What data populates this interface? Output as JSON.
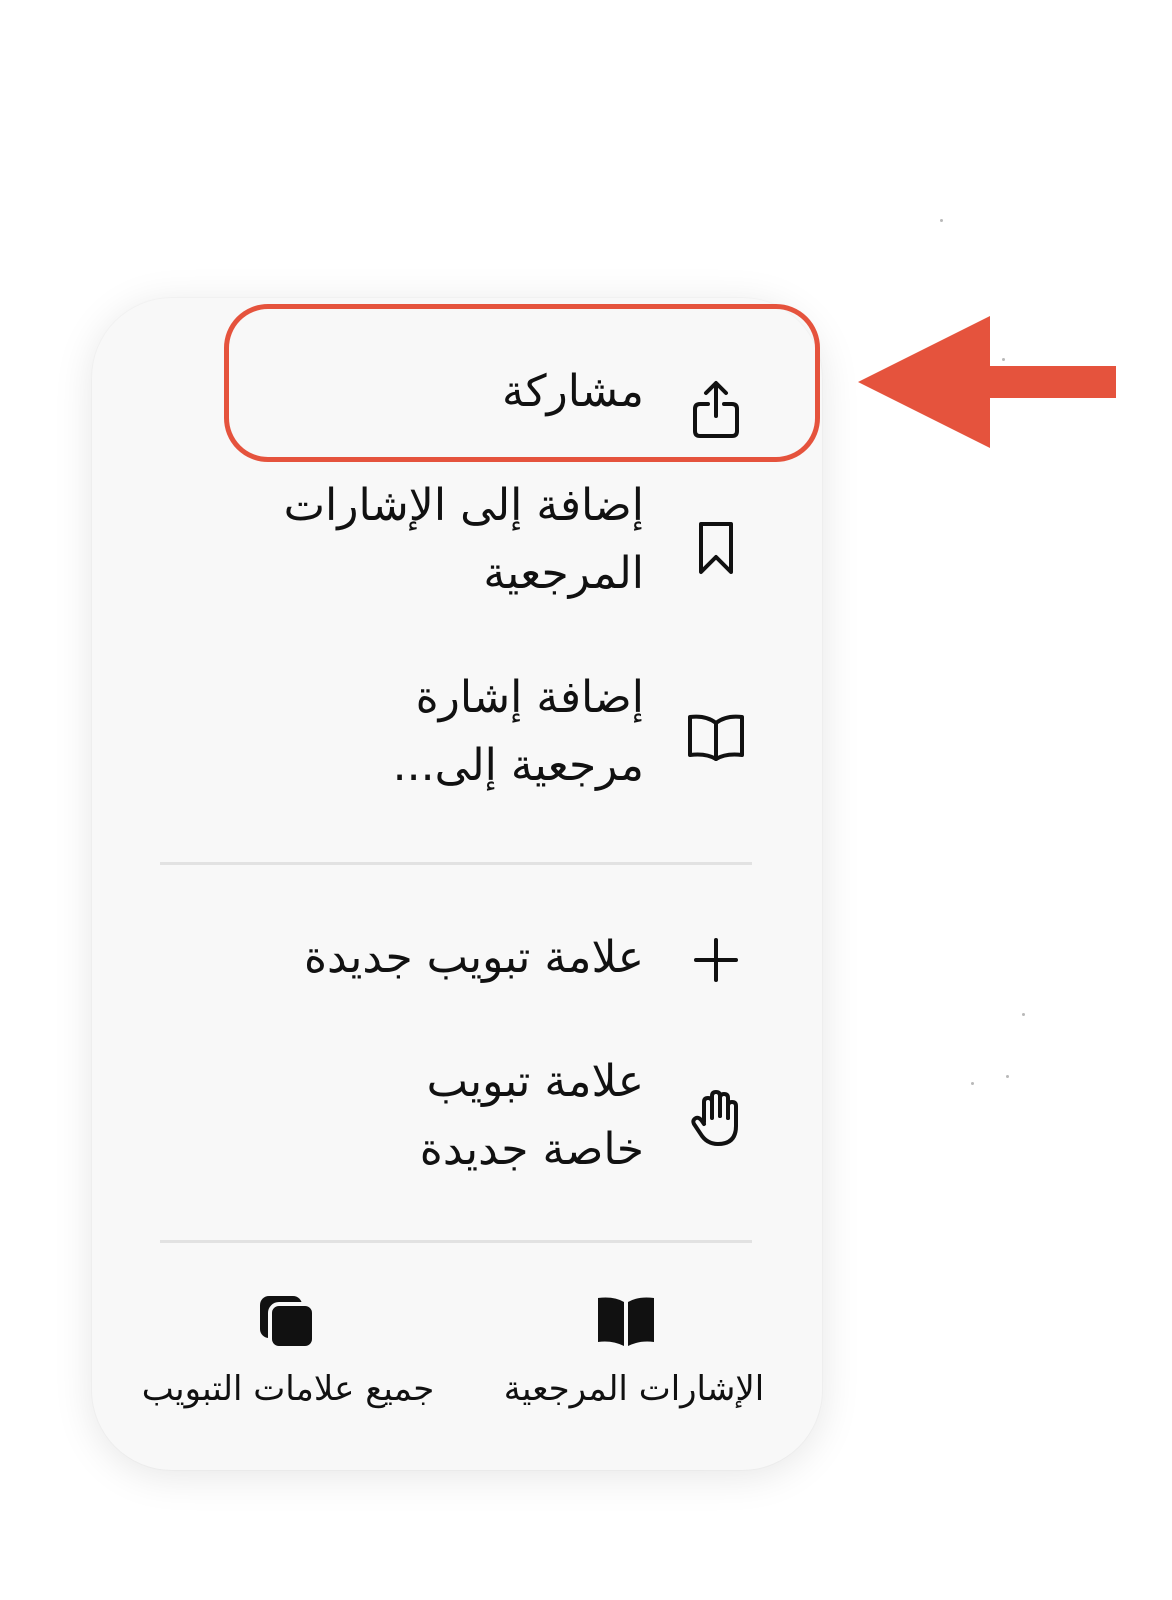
{
  "menu": {
    "items": [
      {
        "id": "share",
        "label_lines": [
          "مشاركة"
        ],
        "icon": "share-icon"
      },
      {
        "id": "add-bookmark",
        "label_lines": [
          "إضافة إلى الإشارات",
          "المرجعية"
        ],
        "icon": "bookmark-icon"
      },
      {
        "id": "add-bookmark-to",
        "label_lines": [
          "إضافة إشارة",
          "مرجعية إلى..."
        ],
        "icon": "open-book-icon"
      },
      {
        "id": "new-tab",
        "label_lines": [
          "علامة تبويب جديدة"
        ],
        "icon": "plus-icon"
      },
      {
        "id": "new-private-tab",
        "label_lines": [
          "علامة تبويب",
          "خاصة جديدة"
        ],
        "icon": "hand-icon"
      }
    ],
    "bottom": {
      "all_tabs": {
        "label": "جميع علامات التبويب",
        "icon": "tabs-icon"
      },
      "bookmarks": {
        "label": "الإشارات المرجعية",
        "icon": "book-filled-icon"
      }
    }
  },
  "annotation": {
    "highlight_color": "#e5533d",
    "arrow_color": "#e5533d",
    "target": "share"
  },
  "colors": {
    "card_bg": "#f8f8f8",
    "divider": "#e2e2e2",
    "text": "#111111"
  }
}
